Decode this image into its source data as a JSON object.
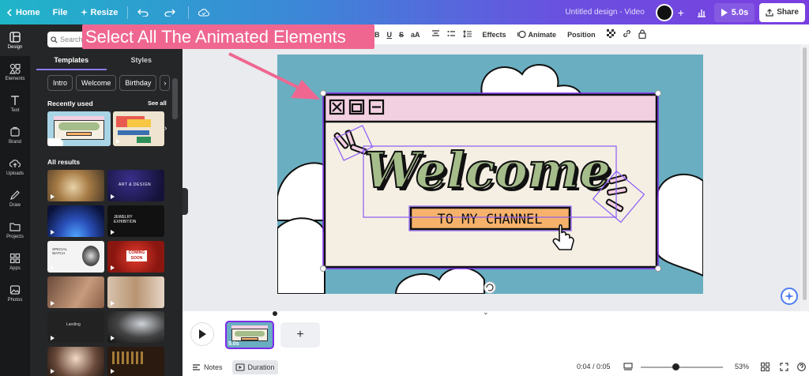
{
  "topbar": {
    "home": "Home",
    "file": "File",
    "resize": "Resize",
    "doc_title": "Untitled design - Video",
    "play_time": "5.0s",
    "share": "Share"
  },
  "rail": [
    {
      "label": "Design",
      "icon": "design-icon"
    },
    {
      "label": "Elements",
      "icon": "elements-icon"
    },
    {
      "label": "Text",
      "icon": "text-icon"
    },
    {
      "label": "Brand",
      "icon": "brand-icon"
    },
    {
      "label": "Uploads",
      "icon": "uploads-icon"
    },
    {
      "label": "Draw",
      "icon": "draw-icon"
    },
    {
      "label": "Projects",
      "icon": "projects-icon"
    },
    {
      "label": "Apps",
      "icon": "apps-icon"
    },
    {
      "label": "Photos",
      "icon": "photos-icon"
    }
  ],
  "panel": {
    "search_placeholder": "Search",
    "tabs": [
      "Templates",
      "Styles"
    ],
    "chips": [
      "Intro",
      "Welcome",
      "Birthday"
    ],
    "recently_used": "Recently used",
    "see_all": "See all",
    "all_results": "All results",
    "result_texts": [
      "ART & DESIGN",
      "JEWELRY EXHIBITION",
      "SPECIAL WATCH",
      "COMING SOON",
      "Landing"
    ]
  },
  "format_toolbar": {
    "effects": "Effects",
    "animate": "Animate",
    "position": "Position"
  },
  "callout": "Select All The Animated Elements",
  "canvas": {
    "headline": "Welcome",
    "subline": "TO MY CHANNEL"
  },
  "timeline": {
    "clip_duration": "5.0s"
  },
  "statusbar": {
    "notes": "Notes",
    "duration": "Duration",
    "time": "0:04 / 0:05",
    "zoom": "53%"
  },
  "colors": {
    "accent": "#7d2ae8",
    "callout": "#ef6791",
    "canvas_bg": "#6aaec1",
    "window_bar": "#f3cfe2",
    "headline_fill": "#a5bd8a"
  }
}
